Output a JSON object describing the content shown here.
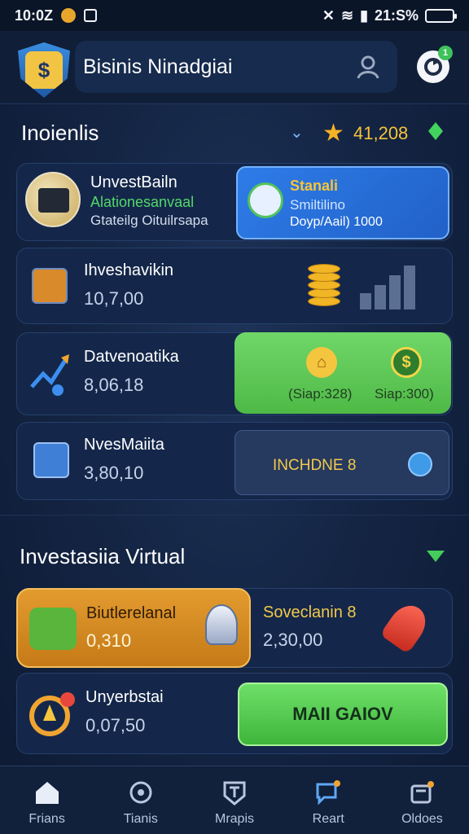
{
  "status": {
    "time": "10:0Z",
    "battery": "21:S%",
    "battery_level": 0.8
  },
  "header": {
    "title": "Bisinis Ninadgiai",
    "badge": "1"
  },
  "section1": {
    "title": "Inoienlis",
    "score": "41,208"
  },
  "rows": [
    {
      "name": "UnvestBailn",
      "sub": "Alationesanvaal",
      "sub2": "Gtateilg Oituilrsapa"
    },
    {
      "name": "Ihveshavikin",
      "value": "10,7,00"
    },
    {
      "name": "Datvenoatika",
      "value": "8,06,18"
    },
    {
      "name": "NvesMaiita",
      "value": "3,80,10"
    }
  ],
  "blue_card": {
    "line1": "Stanali",
    "line2": "Smiltilino",
    "line3": "Doyp/Aail) 1000"
  },
  "green_card": {
    "left_label": "(Siap:328)",
    "right_label": "Siap:300)"
  },
  "increase_label": "INCHDNE 8",
  "section2": {
    "title": "Investasiia Virtual"
  },
  "orange_card": {
    "name": "Biutlerelanal",
    "value": "0,310"
  },
  "portfolio": {
    "name": "Soveclanin 8",
    "value": "2,30,00"
  },
  "bottom_row": {
    "name": "Unyerbstai",
    "value": "0,07,50",
    "button": "MAII GAIOV"
  },
  "nav": [
    {
      "label": "Frians"
    },
    {
      "label": "Tianis"
    },
    {
      "label": "Mrapis"
    },
    {
      "label": "Reart"
    },
    {
      "label": "Oldoes"
    }
  ]
}
